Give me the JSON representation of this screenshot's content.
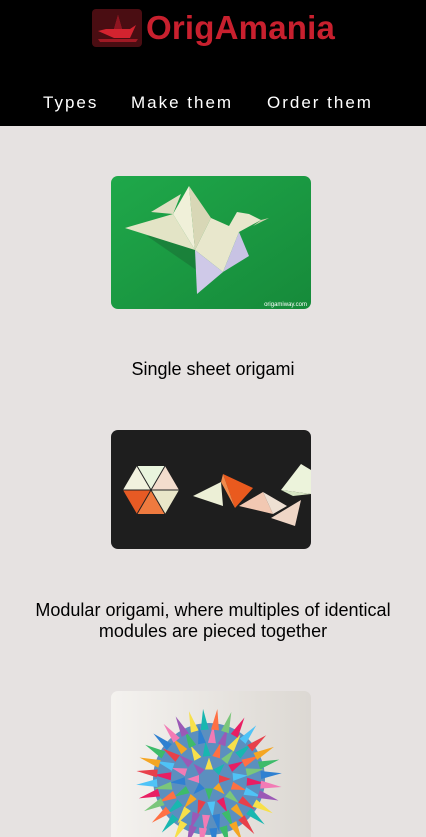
{
  "brand": {
    "name": "OrigAmania",
    "logo_icon": "crane-logo-icon",
    "accent": "#c8202e"
  },
  "nav": {
    "items": [
      "Types",
      "Make them",
      "Order them"
    ]
  },
  "cards": [
    {
      "caption": "Single sheet origami",
      "image": "origami-dove-image",
      "watermark": "origamiway.com"
    },
    {
      "caption": "Modular origami, where multiples of identical modules are pieced together",
      "image": "modular-origami-image"
    },
    {
      "caption": "",
      "image": "kusudama-ball-image"
    }
  ]
}
